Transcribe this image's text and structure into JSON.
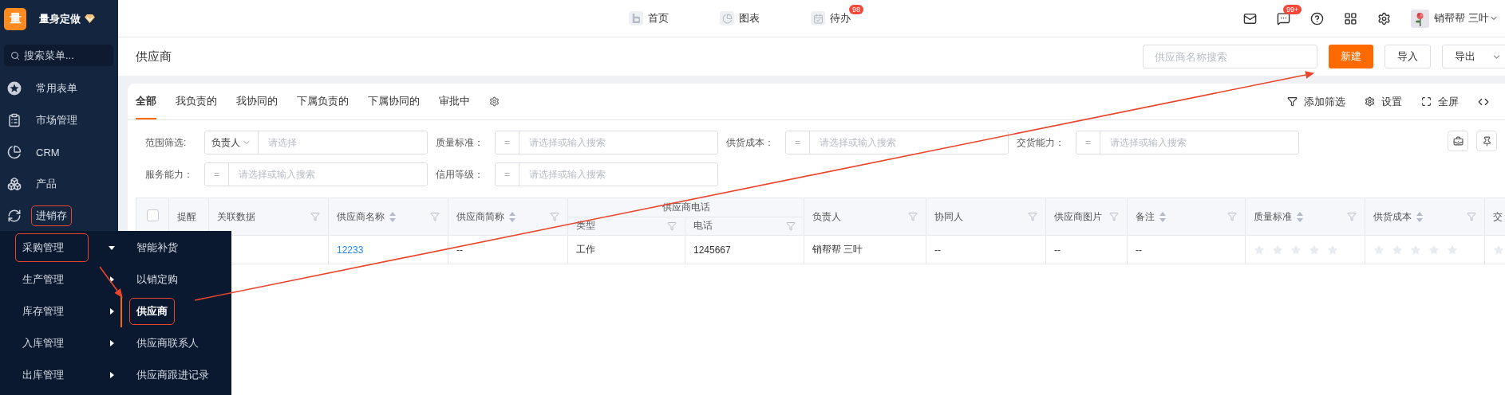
{
  "sidebar": {
    "logo_mark": "量",
    "brand": "量身定做",
    "search_placeholder": "搜索菜单...",
    "items": [
      {
        "label": "常用表单",
        "highlighted": false
      },
      {
        "label": "市场管理",
        "highlighted": false
      },
      {
        "label": "CRM",
        "highlighted": false
      },
      {
        "label": "产品",
        "highlighted": false
      },
      {
        "label": "进销存",
        "highlighted": true
      }
    ]
  },
  "flyout": {
    "groups": [
      {
        "label": "采购管理",
        "expanded": true,
        "highlighted": true
      },
      {
        "label": "生产管理",
        "expanded": false,
        "highlighted": false
      },
      {
        "label": "库存管理",
        "expanded": false,
        "highlighted": false
      },
      {
        "label": "入库管理",
        "expanded": false,
        "highlighted": false
      },
      {
        "label": "出库管理",
        "expanded": false,
        "highlighted": false
      }
    ],
    "items": [
      {
        "label": "智能补货",
        "selected": false,
        "highlighted": false
      },
      {
        "label": "以销定购",
        "selected": false,
        "highlighted": false
      },
      {
        "label": "供应商",
        "selected": true,
        "highlighted": true
      },
      {
        "label": "供应商联系人",
        "selected": false,
        "highlighted": false
      },
      {
        "label": "供应商跟进记录",
        "selected": false,
        "highlighted": false
      }
    ]
  },
  "topbar": {
    "nav": [
      {
        "label": "首页"
      },
      {
        "label": "图表"
      },
      {
        "label": "待办",
        "badge": "98"
      }
    ],
    "chat_badge": "99+",
    "user": "销帮帮 三叶"
  },
  "header": {
    "title": "供应商",
    "search_placeholder": "供应商名称搜索",
    "buttons": [
      {
        "label": "新建",
        "kind": "primary"
      },
      {
        "label": "导入",
        "kind": "default"
      },
      {
        "label": "导出",
        "kind": "dropdown"
      }
    ]
  },
  "tabs": [
    {
      "label": "全部",
      "selected": true
    },
    {
      "label": "我负责的",
      "selected": false
    },
    {
      "label": "我协同的",
      "selected": false
    },
    {
      "label": "下属负责的",
      "selected": false
    },
    {
      "label": "下属协同的",
      "selected": false
    },
    {
      "label": "审批中",
      "selected": false
    }
  ],
  "tools": [
    "添加筛选",
    "设置",
    "全屏"
  ],
  "filters": [
    {
      "label": "范围筛选:",
      "kind": "select",
      "selector": "负责人",
      "placeholder": "请选择"
    },
    {
      "label": "质量标准：",
      "kind": "operator",
      "operator": "=",
      "placeholder": "请选择或输入搜索"
    },
    {
      "label": "供货成本：",
      "kind": "operator",
      "operator": "=",
      "placeholder": "请选择或输入搜索"
    },
    {
      "label": "交货能力：",
      "kind": "operator",
      "operator": "=",
      "placeholder": "请选择或输入搜索"
    },
    {
      "label": "服务能力：",
      "kind": "operator",
      "operator": "=",
      "placeholder": "请选择或输入搜索"
    },
    {
      "label": "信用等级：",
      "kind": "operator",
      "operator": "=",
      "placeholder": "请选择或输入搜索"
    }
  ],
  "table": {
    "select_all": {
      "checked": false
    },
    "columns": [
      {
        "label": "提醒",
        "sortable": false,
        "filterable": false
      },
      {
        "label": "关联数据",
        "sortable": false,
        "filterable": true
      },
      {
        "label": "供应商名称",
        "sortable": true,
        "filterable": true
      },
      {
        "label": "供应商简称",
        "sortable": true,
        "filterable": true
      },
      {
        "label": "供应商电话",
        "colspan": 2,
        "children": [
          {
            "label": "类型",
            "sortable": false,
            "filterable": true
          },
          {
            "label": "电话",
            "sortable": false,
            "filterable": true
          }
        ]
      },
      {
        "label": "负责人",
        "sortable": false,
        "filterable": true
      },
      {
        "label": "协同人",
        "sortable": false,
        "filterable": true
      },
      {
        "label": "供应商图片",
        "sortable": false,
        "filterable": true
      },
      {
        "label": "备注",
        "sortable": true,
        "filterable": true
      },
      {
        "label": "质量标准",
        "sortable": true,
        "filterable": true
      },
      {
        "label": "供货成本",
        "sortable": true,
        "filterable": true
      },
      {
        "label": "交"
      }
    ],
    "rows": [
      {
        "cells": [
          {
            "kind": "empty"
          },
          {
            "kind": "empty"
          },
          {
            "kind": "link",
            "text": "12233"
          },
          {
            "kind": "text",
            "text": "--"
          },
          {
            "kind": "text",
            "text": "工作"
          },
          {
            "kind": "text",
            "text": "1245667"
          },
          {
            "kind": "text",
            "text": "销帮帮 三叶"
          },
          {
            "kind": "text",
            "text": "--"
          },
          {
            "kind": "text",
            "text": "--"
          },
          {
            "kind": "text",
            "text": "--"
          },
          {
            "kind": "stars",
            "stars": 0
          },
          {
            "kind": "stars",
            "stars": 0
          },
          {
            "kind": "stars"
          }
        ]
      }
    ]
  }
}
